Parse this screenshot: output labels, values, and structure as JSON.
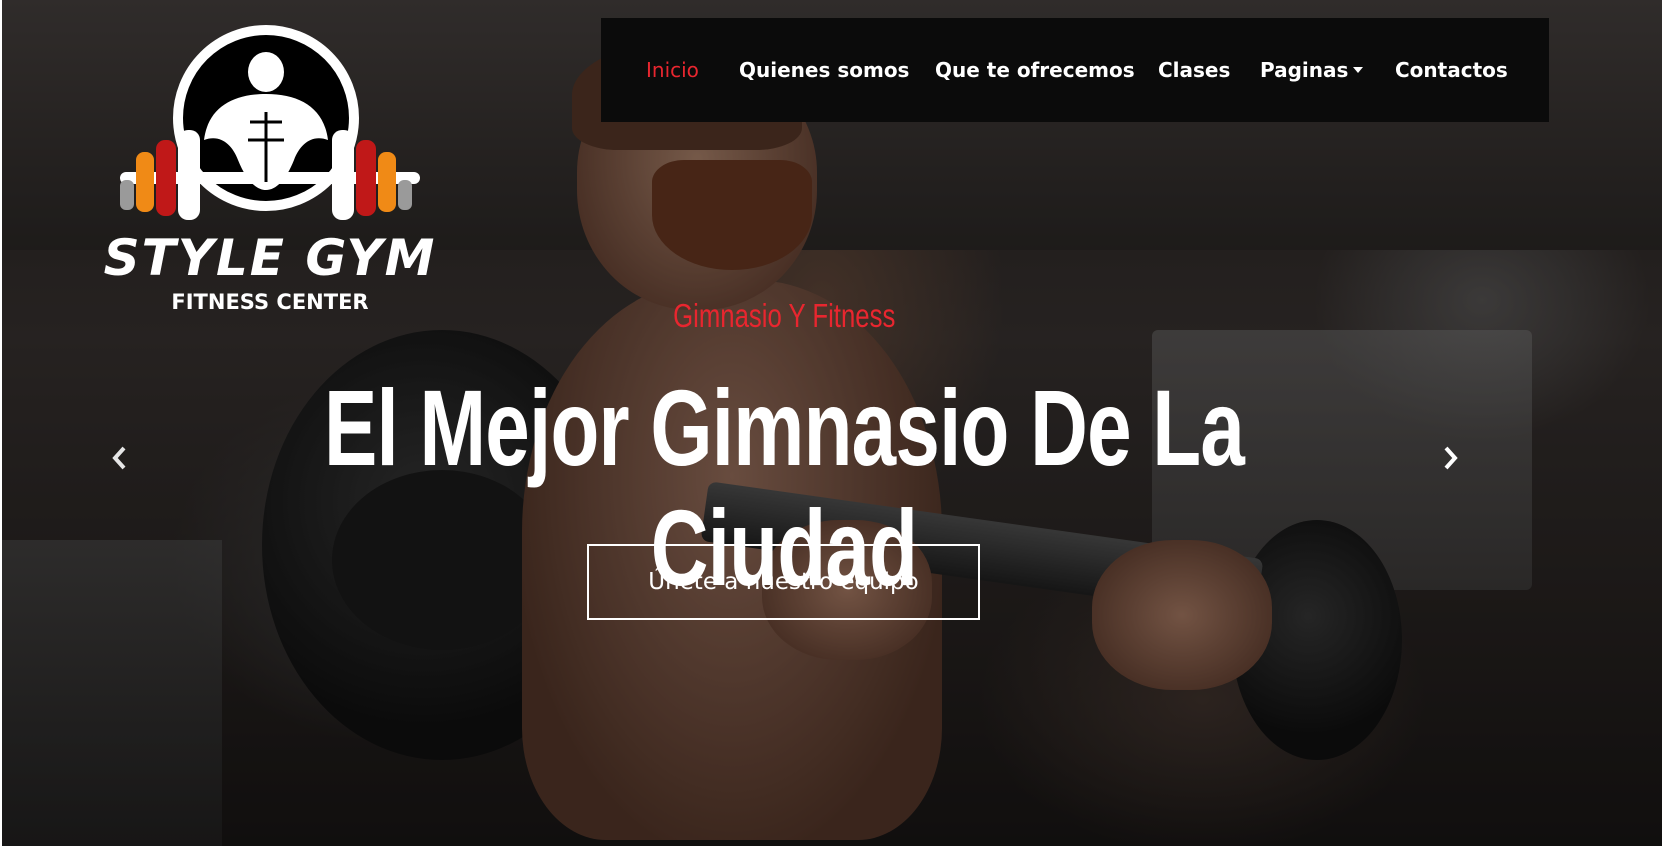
{
  "logo": {
    "title": "STYLE GYM",
    "subtitle": "FITNESS CENTER",
    "icon": "bodybuilder-barbell-icon"
  },
  "nav": {
    "items": [
      {
        "label": "Inicio",
        "active": true
      },
      {
        "label": "Quienes somos"
      },
      {
        "label": "Que te ofrecemos"
      },
      {
        "label": "Clases"
      },
      {
        "label": "Paginas",
        "dropdown": true
      },
      {
        "label": "Contactos"
      }
    ]
  },
  "hero": {
    "subtitle": "Gimnasio Y Fitness",
    "headline": "El Mejor Gimnasio De La Ciudad",
    "cta_label": "Únete a nuestro equipo",
    "prev_icon": "chevron-left-icon",
    "next_icon": "chevron-right-icon"
  },
  "colors": {
    "accent": "#e8262f",
    "navbar": "#0b0b0b",
    "text": "#ffffff"
  }
}
